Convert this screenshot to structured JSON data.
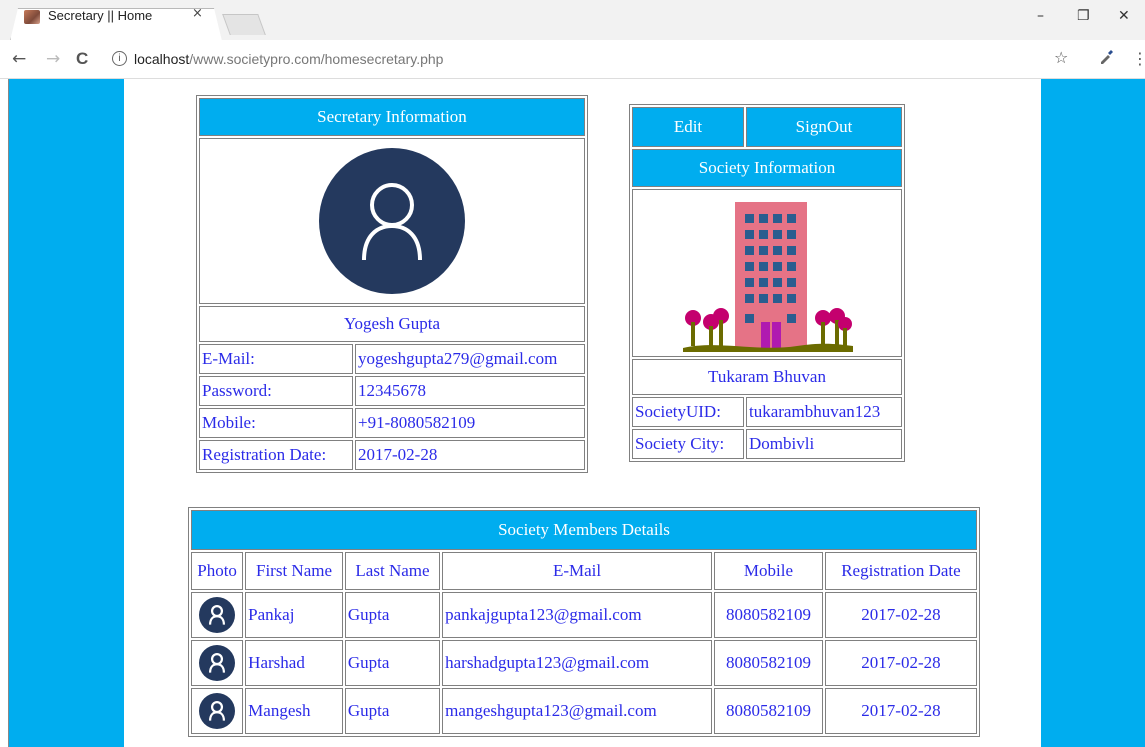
{
  "browser": {
    "tab_title": "Secretary || Home",
    "tab_close": "×",
    "url_host": "localhost",
    "url_path": "/www.societypro.com/homesecretary.php",
    "info_icon": "ⓘ",
    "star": "☆",
    "back": "←",
    "forward": "→",
    "reload": "C",
    "menu": "⋮",
    "min": "–",
    "max": "❐",
    "close": "✕"
  },
  "secretary": {
    "header": "Secretary Information",
    "name": "Yogesh Gupta",
    "fields": [
      {
        "label": "E-Mail:",
        "value": "yogeshgupta279@gmail.com"
      },
      {
        "label": "Password:",
        "value": "12345678"
      },
      {
        "label": "Mobile:",
        "value": "+91-8080582109"
      },
      {
        "label": "Registration Date:",
        "value": "2017-02-28"
      }
    ]
  },
  "society": {
    "edit_label": "Edit",
    "signout_label": "SignOut",
    "header": "Society Information",
    "name": "Tukaram Bhuvan",
    "fields": [
      {
        "label": "SocietyUID:",
        "value": "tukarambhuvan123"
      },
      {
        "label": "Society City:",
        "value": "Dombivli"
      }
    ]
  },
  "members": {
    "header": "Society Members Details",
    "columns": [
      "Photo",
      "First Name",
      "Last Name",
      "E-Mail",
      "Mobile",
      "Registration Date"
    ],
    "rows": [
      {
        "first": "Pankaj",
        "last": "Gupta",
        "email": "pankajgupta123@gmail.com",
        "mobile": "8080582109",
        "date": "2017-02-28"
      },
      {
        "first": "Harshad",
        "last": "Gupta",
        "email": "harshadgupta123@gmail.com",
        "mobile": "8080582109",
        "date": "2017-02-28"
      },
      {
        "first": "Mangesh",
        "last": "Gupta",
        "email": "mangeshgupta123@gmail.com",
        "mobile": "8080582109",
        "date": "2017-02-28"
      }
    ]
  },
  "colors": {
    "accent": "#00adef",
    "link_text": "#2b2be8",
    "avatar": "#24395e"
  },
  "icons": {
    "avatar": "user-avatar-icon",
    "building": "building-icon"
  }
}
